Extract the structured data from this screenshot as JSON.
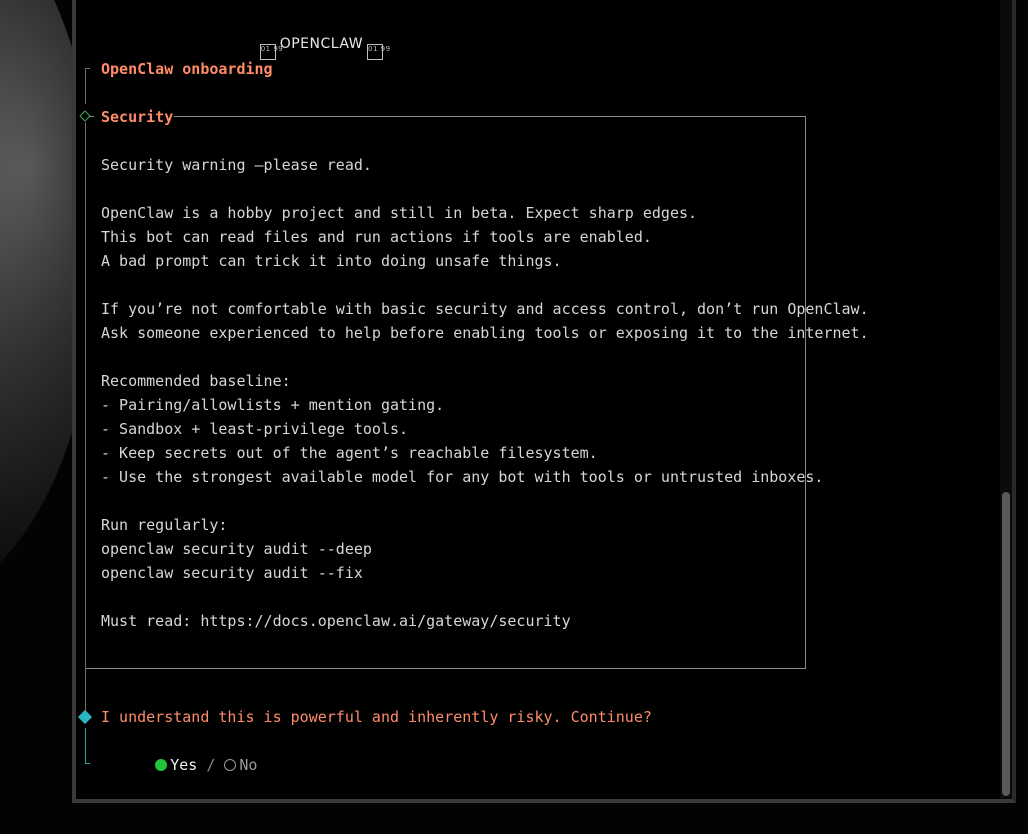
{
  "terminal": {
    "banner_text": "OPENCLAW",
    "banner_glyph": "01 99",
    "title": "OpenClaw onboarding",
    "note": {
      "title": "Security",
      "lines": [
        "Security warning —please read.",
        "",
        "OpenClaw is a hobby project and still in beta. Expect sharp edges.",
        "This bot can read files and run actions if tools are enabled.",
        "A bad prompt can trick it into doing unsafe things.",
        "",
        "If you’re not comfortable with basic security and access control, don’t run OpenClaw.",
        "Ask someone experienced to help before enabling tools or exposing it to the internet.",
        "",
        "Recommended baseline:",
        "- Pairing/allowlists + mention gating.",
        "- Sandbox + least-privilege tools.",
        "- Keep secrets out of the agent’s reachable filesystem.",
        "- Use the strongest available model for any bot with tools or untrusted inboxes.",
        "",
        "Run regularly:",
        "openclaw security audit --deep",
        "openclaw security audit --fix",
        "",
        "Must read: https://docs.openclaw.ai/gateway/security"
      ]
    },
    "confirm": {
      "question": "I understand this is powerful and inherently risky. Continue?",
      "yes_label": "Yes",
      "separator": "/",
      "no_label": "No",
      "selected": "Yes"
    }
  },
  "colors": {
    "accent": "#ff8c69",
    "selected_radio": "#22c43a",
    "prompt_diamond": "#2ab7c2",
    "section_diamond": "#3fb34f"
  }
}
